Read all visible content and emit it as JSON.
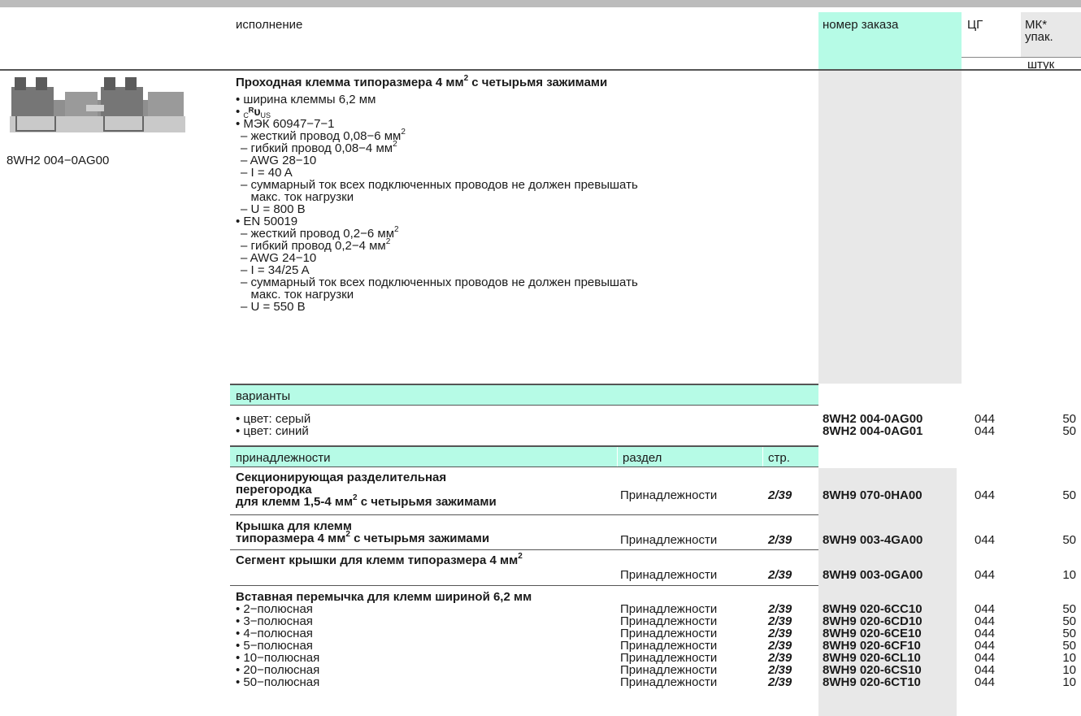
{
  "header": {
    "col_design": "исполнение",
    "col_order": "номер заказа",
    "col_pg": "ЦГ",
    "col_pack": "МК*",
    "col_pack2": "упак.",
    "col_unit": "штук"
  },
  "product": {
    "image_caption": "8WH2 004−0AG00",
    "title": "Проходная клемма типоразмера 4 мм",
    "title_sup": "2",
    "title_tail": " с четырьмя зажимами",
    "cert_c": "C",
    "cert_us": "US",
    "spec_width": "• ширина клеммы 6,2 мм",
    "iec_header": "• МЭК 60947−7−1",
    "iec_specs": [
      [
        "– жесткий провод 0,08−6 мм",
        "2"
      ],
      [
        "– гибкий провод 0,08−4 мм",
        "2"
      ],
      [
        "– AWG 28−10",
        ""
      ],
      [
        "– I = 40 A",
        ""
      ],
      [
        "– суммарный ток всех подключенных проводов не должен превышать",
        ""
      ],
      [
        "   макс. ток нагрузки",
        ""
      ],
      [
        "– U = 800 В",
        ""
      ]
    ],
    "en_header": "• EN 50019",
    "en_specs": [
      [
        "– жесткий провод 0,2−6 мм",
        "2"
      ],
      [
        "– гибкий провод 0,2−4 мм",
        "2"
      ],
      [
        "– AWG 24−10",
        ""
      ],
      [
        "– I = 34/25 A",
        ""
      ],
      [
        "– суммарный ток всех подключенных проводов не должен превышать",
        ""
      ],
      [
        "   макс. ток нагрузки",
        ""
      ],
      [
        "– U = 550 В",
        ""
      ]
    ]
  },
  "variants": {
    "header": "варианты",
    "items": [
      {
        "label": "• цвет: серый",
        "order": "8WH2 004-0AG00",
        "pg": "044",
        "qty": "50"
      },
      {
        "label": "• цвет: синий",
        "order": "8WH2 004-0AG01",
        "pg": "044",
        "qty": "50"
      }
    ]
  },
  "accessories": {
    "header": "принадлежности",
    "col_section": "раздел",
    "col_page": "стр.",
    "groups": [
      {
        "title_lines": [
          "Секционирующая разделительная",
          "перегородка"
        ],
        "title_last": "для клемм 1,5-4 мм",
        "title_last_sup": "2",
        "title_last_tail": " с четырьмя зажимами",
        "section": "Принадлежности",
        "page": "2/39",
        "order": "8WH9 070-0HA00",
        "pg": "044",
        "qty": "50"
      },
      {
        "title_lines": [
          "Крышка для клемм"
        ],
        "title_last": "типоразмера 4 мм",
        "title_last_sup": "2",
        "title_last_tail": " с четырьмя зажимами",
        "section": "Принадлежности",
        "page": "2/39",
        "order": "8WH9 003-4GA00",
        "pg": "044",
        "qty": "50"
      },
      {
        "title_lines": [],
        "title_last": "Сегмент крышки для клемм типоразмера 4 мм",
        "title_last_sup": "2",
        "title_last_tail": "",
        "section": "Принадлежности",
        "page": "2/39",
        "order": "8WH9 003-0GA00",
        "pg": "044",
        "qty": "10"
      }
    ],
    "jumper": {
      "title": "Вставная перемычка для клемм шириной 6,2 мм",
      "rows": [
        {
          "label": "• 2−полюсная",
          "section": "Принадлежности",
          "page": "2/39",
          "order": "8WH9 020-6CC10",
          "pg": "044",
          "qty": "50"
        },
        {
          "label": "• 3−полюсная",
          "section": "Принадлежности",
          "page": "2/39",
          "order": "8WH9 020-6CD10",
          "pg": "044",
          "qty": "50"
        },
        {
          "label": "• 4−полюсная",
          "section": "Принадлежности",
          "page": "2/39",
          "order": "8WH9 020-6CE10",
          "pg": "044",
          "qty": "50"
        },
        {
          "label": "• 5−полюсная",
          "section": "Принадлежности",
          "page": "2/39",
          "order": "8WH9 020-6CF10",
          "pg": "044",
          "qty": "50"
        },
        {
          "label": "• 10−полюсная",
          "section": "Принадлежности",
          "page": "2/39",
          "order": "8WH9 020-6CL10",
          "pg": "044",
          "qty": "10"
        },
        {
          "label": "• 20−полюсная",
          "section": "Принадлежности",
          "page": "2/39",
          "order": "8WH9 020-6CS10",
          "pg": "044",
          "qty": "10"
        },
        {
          "label": "• 50−полюсная",
          "section": "Принадлежности",
          "page": "2/39",
          "order": "8WH9 020-6CT10",
          "pg": "044",
          "qty": "10"
        }
      ]
    }
  },
  "colors": {
    "accent_green": "#b6fbe6",
    "column_grey": "#e8e8e8",
    "top_bar": "#bcbcbc"
  }
}
